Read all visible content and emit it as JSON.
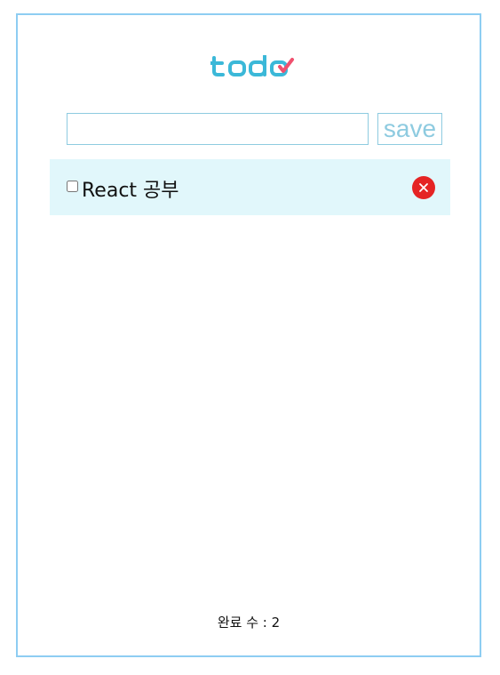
{
  "app": {
    "logo_text": "todo",
    "colors": {
      "frame_border": "#8ecdf2",
      "accent": "#3bb8d8",
      "logo_check": "#f0506e",
      "item_background": "#e1f7fb",
      "delete": "#e52424"
    }
  },
  "form": {
    "input_value": "",
    "input_placeholder": "",
    "save_label": "save"
  },
  "todos": [
    {
      "text": "React 공부",
      "checked": false,
      "delete_icon": "close-icon"
    }
  ],
  "footer": {
    "completed_label": "완료 수 : 2"
  }
}
